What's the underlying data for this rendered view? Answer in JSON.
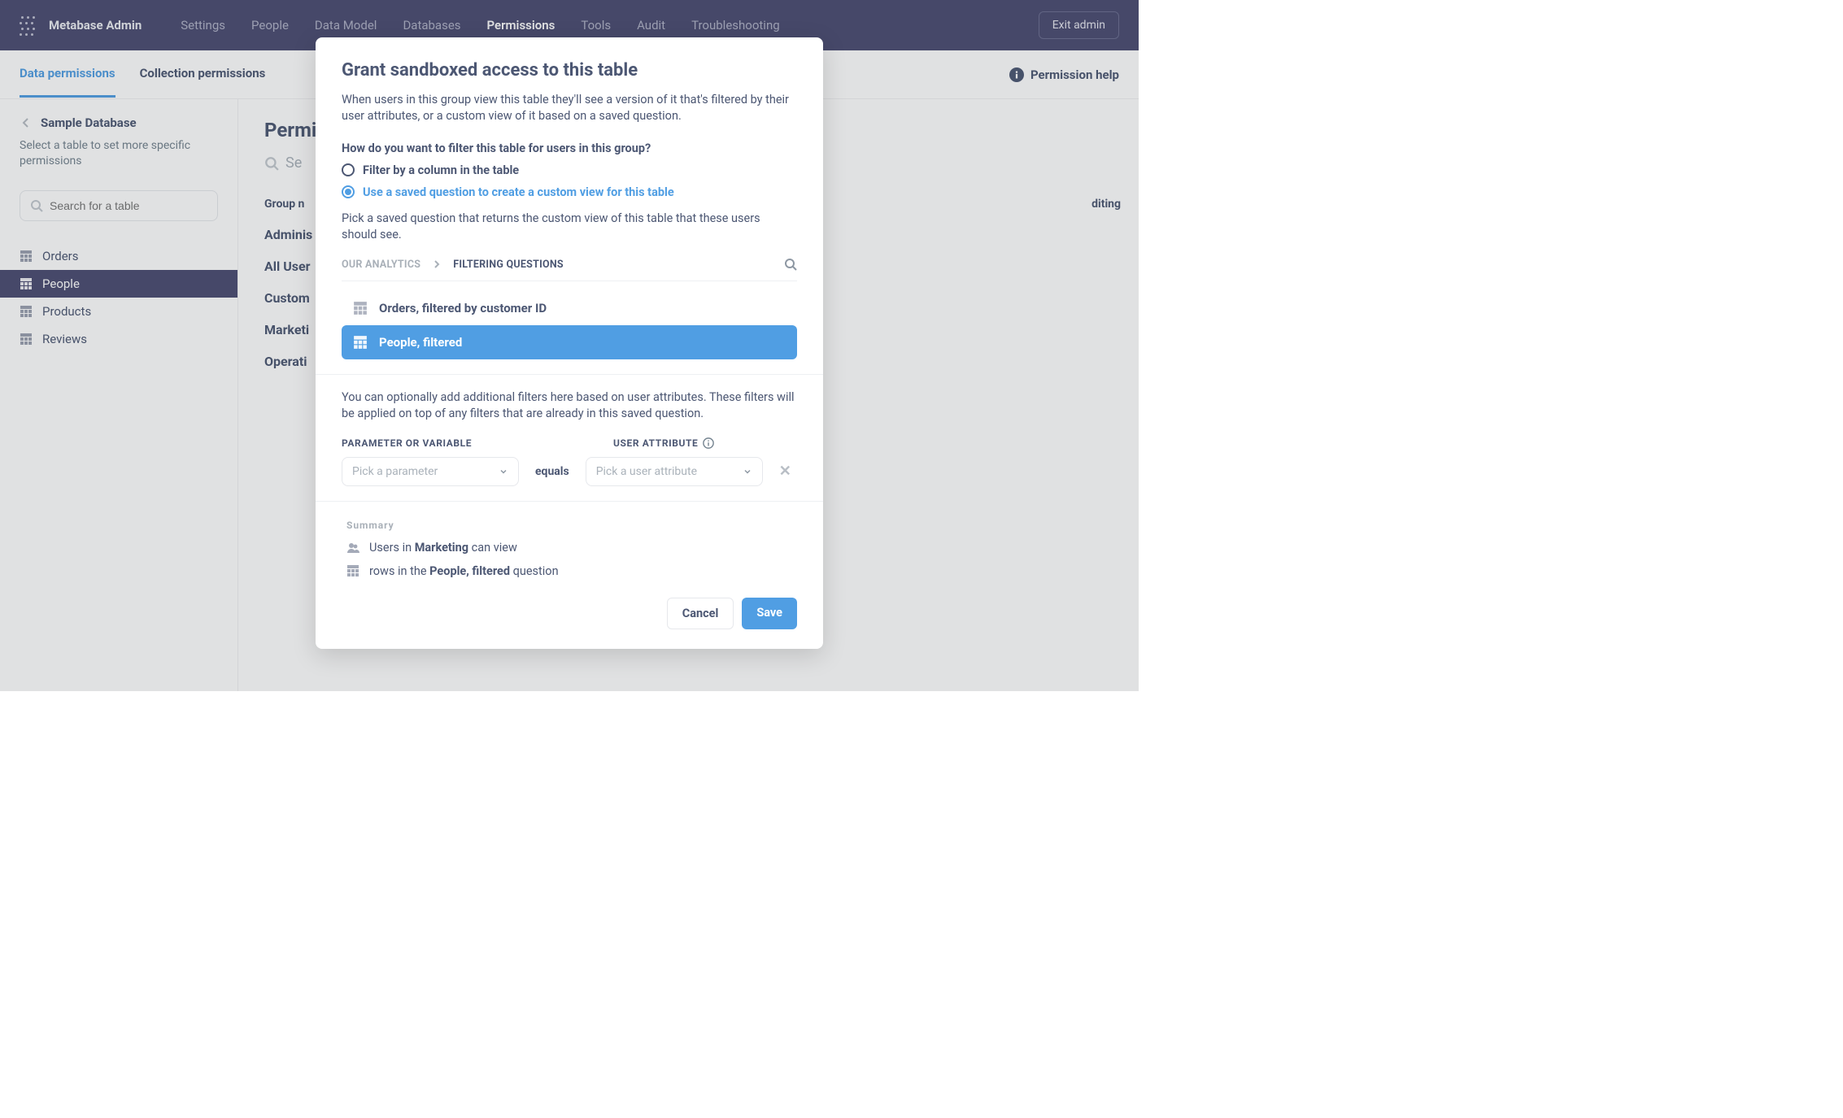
{
  "header": {
    "brand": "Metabase Admin",
    "nav": [
      "Settings",
      "People",
      "Data Model",
      "Databases",
      "Permissions",
      "Tools",
      "Audit",
      "Troubleshooting"
    ],
    "active_nav": "Permissions",
    "exit": "Exit admin"
  },
  "tabs": {
    "items": [
      "Data permissions",
      "Collection permissions"
    ],
    "active": "Data permissions",
    "help": "Permission help"
  },
  "sidebar": {
    "back": "Sample Database",
    "sub": "Select a table to set more specific permissions",
    "search_placeholder": "Search for a table",
    "items": [
      "Orders",
      "People",
      "Products",
      "Reviews"
    ],
    "active": "People"
  },
  "content": {
    "title_prefix": "Permi",
    "search_prefix": "Se",
    "group_head": "Group n",
    "groups": [
      "Adminis",
      "All User",
      "Custom",
      "Marketi",
      "Operati"
    ],
    "right_col_hint": "diting"
  },
  "modal": {
    "title": "Grant sandboxed access to this table",
    "desc": "When users in this group view this table they'll see a version of it that's filtered by their user attributes, or a custom view of it based on a saved question.",
    "question": "How do you want to filter this table for users in this group?",
    "radio1": "Filter by a column in the table",
    "radio2": "Use a saved question to create a custom view for this table",
    "pick_desc": "Pick a saved question that returns the custom view of this table that these users should see.",
    "crumb_root": "Our Analytics",
    "crumb_current": "Filtering questions",
    "questions": [
      "Orders, filtered by customer ID",
      "People, filtered"
    ],
    "selected_question": "People, filtered",
    "extra_desc": "You can optionally add additional filters here based on user attributes. These filters will be applied on top of any filters that are already in this saved question.",
    "param_label": "Parameter or variable",
    "attr_label": "User attribute",
    "param_placeholder": "Pick a parameter",
    "attr_placeholder": "Pick a user attribute",
    "equals": "equals",
    "summary_label": "Summary",
    "sum1_pre": "Users in ",
    "sum1_b": "Marketing",
    "sum1_post": " can view",
    "sum2_pre": "rows in the ",
    "sum2_b": "People, filtered",
    "sum2_post": " question",
    "cancel": "Cancel",
    "save": "Save"
  }
}
